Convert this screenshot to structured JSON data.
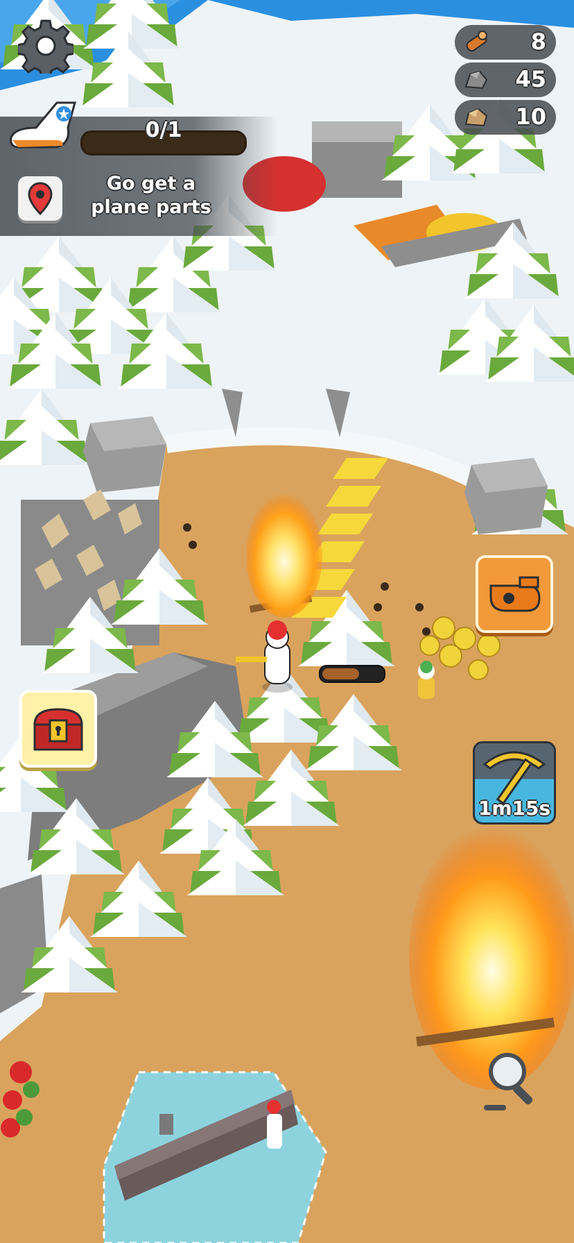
{
  "quest": {
    "progress_text": "0/1",
    "progress_fraction": 0,
    "description": "Go get a plane parts"
  },
  "resources": [
    {
      "icon": "wood-log-icon",
      "value": "8"
    },
    {
      "icon": "stone-icon",
      "value": "45"
    },
    {
      "icon": "ore-icon",
      "value": "10"
    }
  ],
  "pickaxe_timer": "1m15s",
  "worker_progress_fraction": 0.65,
  "icons": {
    "settings": "gear-icon",
    "plane": "plane-icon",
    "map_pin": "map-pin-icon",
    "whistle": "whistle-icon",
    "chest": "treasure-chest-icon",
    "pickaxe": "pickaxe-icon",
    "zoom": "magnifier-icon"
  },
  "colors": {
    "snow": "#eef3f7",
    "sand": "#d9a35d",
    "tree_green": "#7cb84a",
    "rock": "#8e8e8e",
    "water": "#2b8fe0",
    "fire": "#ffb21c",
    "workbench_zone": "#7fdcf5"
  }
}
